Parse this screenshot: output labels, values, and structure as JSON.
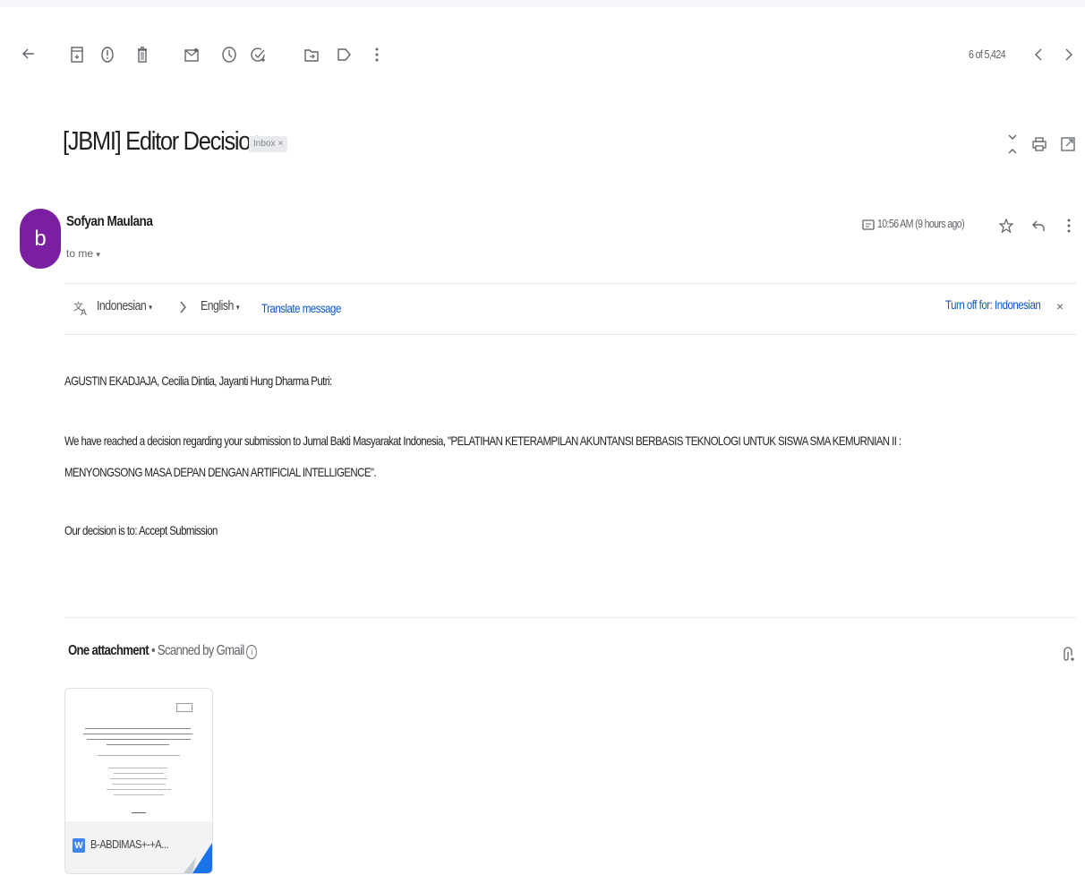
{
  "toolbar": {
    "icons": [
      "back-arrow-icon",
      "archive-icon",
      "report-spam-icon",
      "delete-icon",
      "mark-unread-icon",
      "snooze-icon",
      "add-task-icon",
      "move-to-icon",
      "label-icon",
      "more-vert-icon"
    ],
    "pagination": "6 of 5,424"
  },
  "email": {
    "subject": "[JBMI] Editor Decision",
    "label_chip": "Inbox",
    "label_close": "×",
    "sender_initial": "b",
    "sender_name": "Sofyan Maulana",
    "recipient": "to me",
    "time": "10:56 AM (9 hours ago)"
  },
  "translate": {
    "source_lang": "Indonesian",
    "target_lang": "English",
    "translate_link": "Translate message",
    "turn_off": "Turn off for: Indonesian",
    "close": "×"
  },
  "body": {
    "line1": "AGUSTIN EKADJAJA, Cecilia Dintia, Jayanti Hung Dharma Putri:",
    "line2": "We have reached a decision regarding your submission to Jurnal Bakti Masyarakat Indonesia, \"PELATIHAN KETERAMPILAN AKUNTANSI BERBASIS TEKNOLOGI UNTUK SISWA SMA KEMURNIAN II :",
    "line3": "MENYONGSONG MASA DEPAN DENGAN ARTIFICIAL INTELLIGENCE\".",
    "line4": "Our decision is to: Accept Submission"
  },
  "attachments": {
    "title": "One attachment",
    "scanned": " • Scanned by Gmail",
    "file_name": "B-ABDIMAS+-+A...",
    "file_type_badge": "W"
  },
  "colors": {
    "accent_link": "#0b57d0",
    "avatar": "#7b1fa2",
    "word_blue": "#4285f4"
  }
}
